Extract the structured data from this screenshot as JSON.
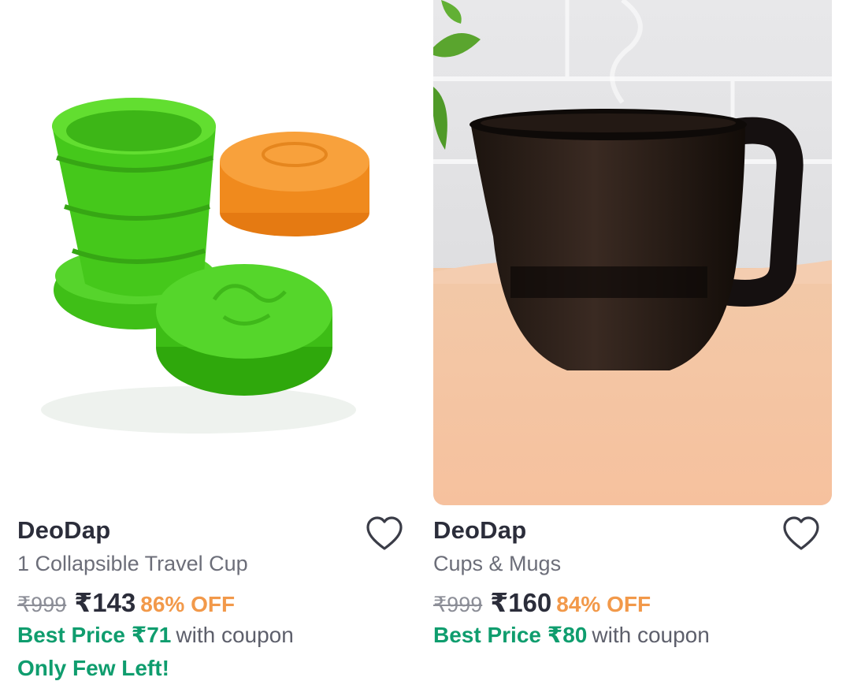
{
  "products": [
    {
      "brand": "DeoDap",
      "title": "1 Collapsible Travel Cup",
      "mrp": "₹999",
      "price": "₹143",
      "discount": "86% OFF",
      "best_price": "Best Price ₹71",
      "coupon_text": "with coupon",
      "stock_note": "Only Few Left!"
    },
    {
      "brand": "DeoDap",
      "title": "Cups & Mugs",
      "mrp": "₹999",
      "price": "₹160",
      "discount": "84% OFF",
      "best_price": "Best Price ₹80",
      "coupon_text": "with coupon"
    }
  ],
  "icons": {
    "wishlist": "heart-outline-icon"
  },
  "colors": {
    "discount": "#f2994a",
    "best_price": "#0f9d6e",
    "text_dark": "#2b2d3a",
    "text_muted": "#6c6e79"
  }
}
